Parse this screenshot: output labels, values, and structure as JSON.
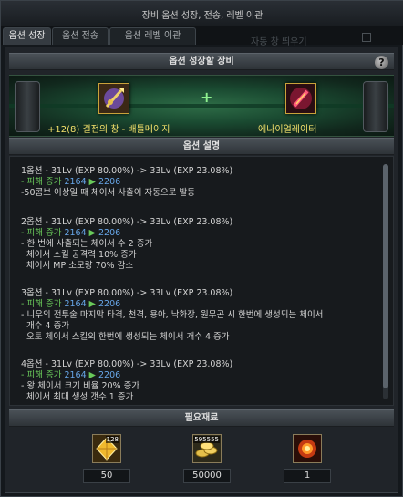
{
  "window": {
    "title": "장비 옵션 성장, 전송, 레벨 이관"
  },
  "tabs": [
    {
      "label": "옵션 성장",
      "active": true
    },
    {
      "label": "옵션 전송",
      "active": false
    },
    {
      "label": "옵션 레벨 이관",
      "active": false
    }
  ],
  "background_text": {
    "auto_label": "자동 창 띄우기"
  },
  "growth": {
    "header": "옵션 성장할 장비",
    "help_glyph": "?",
    "plus": "+",
    "left_item": {
      "name": "+12(8) 결전의 창 - 배틀메이지",
      "icon": "battle-mage-spear-icon"
    },
    "right_item": {
      "name": "에나이얼레이터",
      "icon": "enerator-weapon-icon"
    }
  },
  "options": {
    "header": "옵션 설명",
    "blocks": [
      {
        "title": "1옵션 - 31Lv (EXP 80.00%) -> 33Lv (EXP 23.08%)",
        "dmg_prefix": "- 피해 증가 ",
        "dmg_from": "2164",
        "arrow": " ▶ ",
        "dmg_to": "2206",
        "lines": [
          "-50콤보 이상일 때 체이서 사출이 자동으로 발동"
        ]
      },
      {
        "title": "2옵션 - 31Lv (EXP 80.00%) -> 33Lv (EXP 23.08%)",
        "dmg_prefix": "- 피해 증가 ",
        "dmg_from": "2164",
        "arrow": " ▶ ",
        "dmg_to": "2206",
        "lines": [
          "- 한 번에 사출되는 체이서 수 2 증가",
          "  체이서 스킬 공격력 10% 증가",
          "  체이서 MP 소모량 70% 감소"
        ]
      },
      {
        "title": "3옵션 - 31Lv (EXP 80.00%) -> 33Lv (EXP 23.08%)",
        "dmg_prefix": "- 피해 증가 ",
        "dmg_from": "2164",
        "arrow": " ▶ ",
        "dmg_to": "2206",
        "lines": [
          "- 니우의 전투술 마지막 타격, 천격, 용아, 낙화장, 원무곤 시 한번에 생성되는 체이서",
          "  개수 4 증가",
          "  오토 체이서 스킬의 한번에 생성되는 체이서 개수 4 증가"
        ]
      },
      {
        "title": "4옵션 - 31Lv (EXP 80.00%) -> 33Lv (EXP 23.08%)",
        "dmg_prefix": "- 피해 증가 ",
        "dmg_from": "2164",
        "arrow": " ▶ ",
        "dmg_to": "2206",
        "lines": [
          "- 왕 체이서 크기 비율 20% 증가",
          "  체이서 최대 생성 갯수 1 증가"
        ]
      }
    ]
  },
  "materials": {
    "header": "필요재료",
    "items": [
      {
        "icon": "gold-crystal-icon",
        "badge": "128",
        "qty": "50"
      },
      {
        "icon": "gold-coins-icon",
        "badge": "595555",
        "qty": "50000"
      },
      {
        "icon": "fire-orb-icon",
        "badge": "",
        "qty": "1"
      }
    ]
  },
  "colors": {
    "accent_green": "#69c85a",
    "value_blue": "#67a6e8",
    "item_yellow": "#f2e06a"
  }
}
